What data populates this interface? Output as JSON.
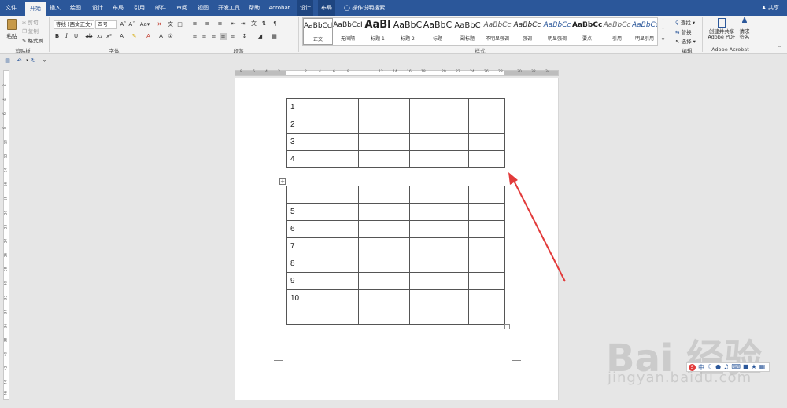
{
  "tabs": [
    {
      "label": "文件",
      "active": false
    },
    {
      "label": "开始",
      "active": true
    },
    {
      "label": "插入",
      "active": false
    },
    {
      "label": "绘图",
      "active": false
    },
    {
      "label": "设计",
      "active": false
    },
    {
      "label": "布局",
      "active": false
    },
    {
      "label": "引用",
      "active": false
    },
    {
      "label": "邮件",
      "active": false
    },
    {
      "label": "审阅",
      "active": false
    },
    {
      "label": "视图",
      "active": false
    },
    {
      "label": "开发工具",
      "active": false
    },
    {
      "label": "帮助",
      "active": false
    },
    {
      "label": "Acrobat",
      "active": false
    },
    {
      "label": "设计",
      "active": false
    },
    {
      "label": "布局",
      "active": false
    }
  ],
  "tell_me": "操作说明搜索",
  "share": "共享",
  "clipboard": {
    "paste": "粘贴",
    "cut": "剪切",
    "copy": "复制",
    "format_painter": "格式刷",
    "label": "剪贴板"
  },
  "font": {
    "name": "等线 (西文正文)",
    "size": "四号",
    "label": "字体"
  },
  "paragraph": {
    "label": "段落"
  },
  "styles": {
    "label": "样式",
    "items": [
      {
        "sample": "AaBbCcI",
        "name": "正文"
      },
      {
        "sample": "AaBbCcI",
        "name": "无间隔"
      },
      {
        "sample": "AaBl",
        "name": "标题 1"
      },
      {
        "sample": "AaBbC",
        "name": "标题 2"
      },
      {
        "sample": "AaBbC",
        "name": "标题"
      },
      {
        "sample": "AaBbC",
        "name": "副标题"
      },
      {
        "sample": "AaBbCc",
        "name": "不明显强调"
      },
      {
        "sample": "AaBbCc",
        "name": "强调"
      },
      {
        "sample": "AaBbCc",
        "name": "明显强调"
      },
      {
        "sample": "AaBbCc",
        "name": "要点"
      },
      {
        "sample": "AaBbCc",
        "name": "引用"
      },
      {
        "sample": "AaBbCc",
        "name": "明显引用"
      }
    ]
  },
  "editing": {
    "find": "查找",
    "replace": "替换",
    "select": "选择",
    "label": "编辑"
  },
  "acrobat": {
    "create_share": "创建并共享 Adobe PDF",
    "request_sign": "请求签名",
    "label": "Adobe Acrobat"
  },
  "ruler_numbers": [
    "8",
    "6",
    "4",
    "2",
    "2",
    "4",
    "6",
    "8",
    "12",
    "14",
    "16",
    "18",
    "20",
    "22",
    "24",
    "26",
    "28",
    "30",
    "32",
    "34"
  ],
  "vruler_numbers": [
    "2",
    "4",
    "6",
    "8",
    "10",
    "12",
    "14",
    "16",
    "18",
    "20",
    "22",
    "24",
    "26",
    "28",
    "30",
    "32",
    "34",
    "36",
    "38",
    "40",
    "42",
    "44",
    "46"
  ],
  "table1": {
    "rows": [
      [
        "1",
        "",
        "",
        ""
      ],
      [
        "2",
        "",
        "",
        ""
      ],
      [
        "3",
        "",
        "",
        ""
      ],
      [
        "4",
        "",
        "",
        ""
      ]
    ]
  },
  "table2": {
    "rows": [
      [
        "",
        "",
        "",
        ""
      ],
      [
        "5",
        "",
        "",
        ""
      ],
      [
        "6",
        "",
        "",
        ""
      ],
      [
        "7",
        "",
        "",
        ""
      ],
      [
        "8",
        "",
        "",
        ""
      ],
      [
        "9",
        "",
        "",
        ""
      ],
      [
        "10",
        "",
        "",
        ""
      ],
      [
        "",
        "",
        "",
        ""
      ]
    ]
  },
  "watermark": {
    "logo": "Bai 经验",
    "url": "jingyan.baidu.com"
  },
  "annotation_color": "#e23a3a",
  "brand_color": "#2b579a"
}
